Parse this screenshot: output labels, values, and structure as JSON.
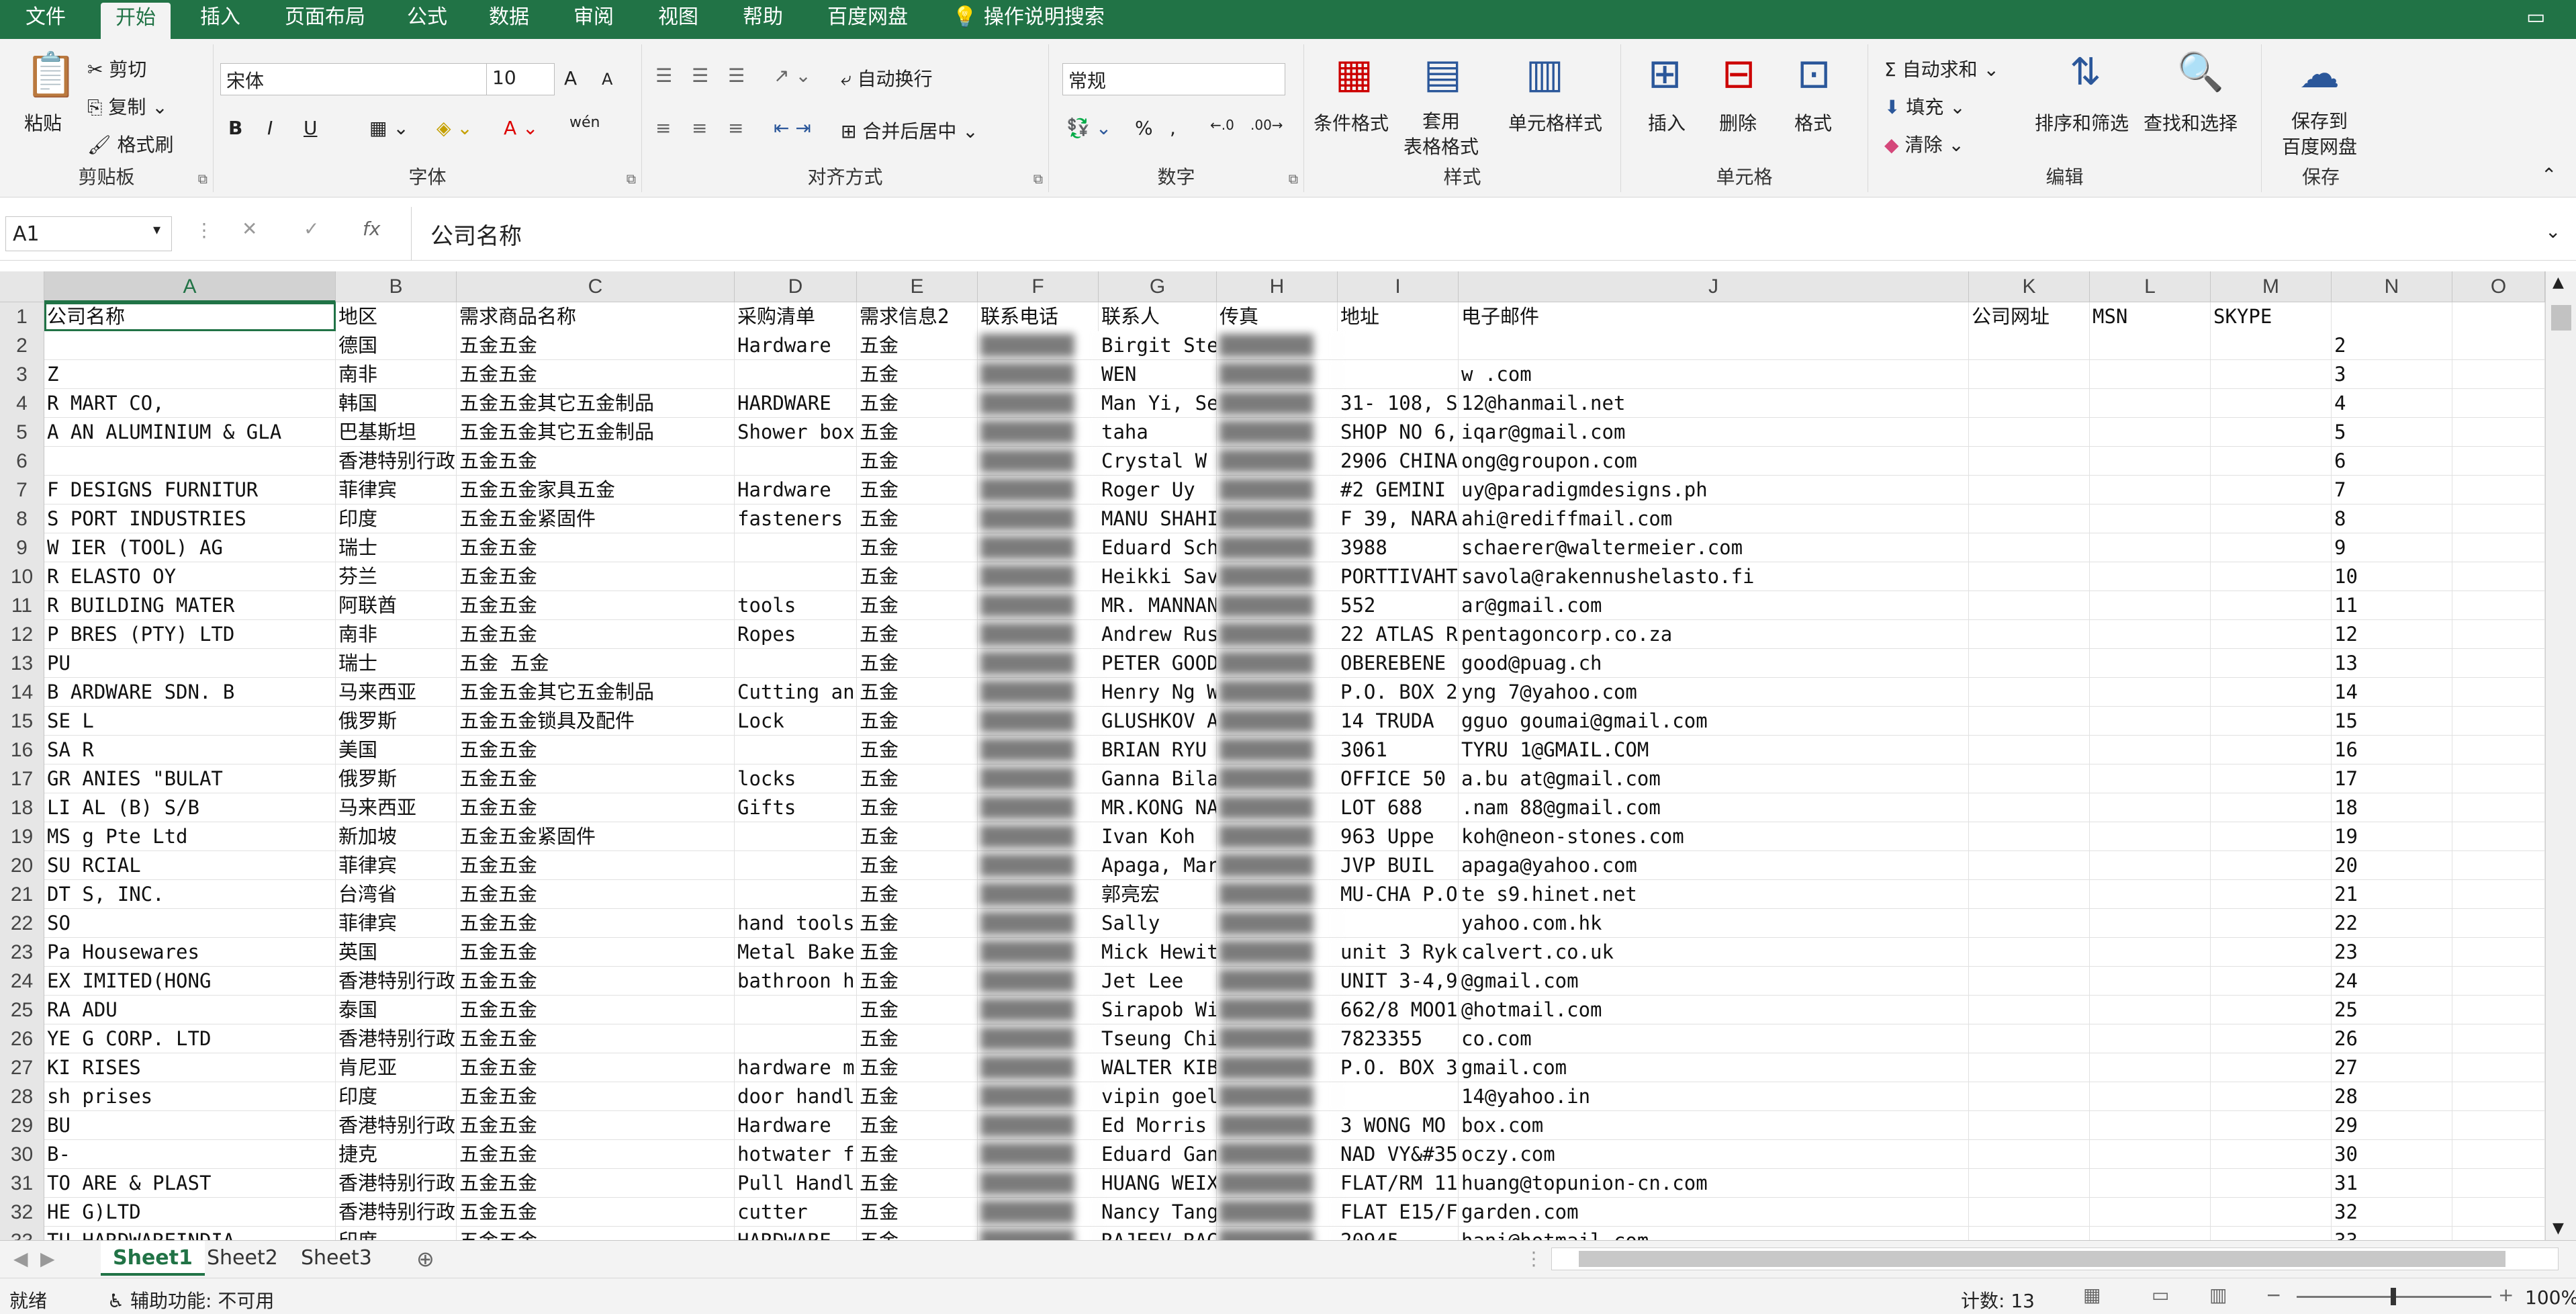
{
  "menu": {
    "tabs": [
      "文件",
      "开始",
      "插入",
      "页面布局",
      "公式",
      "数据",
      "审阅",
      "视图",
      "帮助",
      "百度网盘"
    ],
    "active_tab": "开始",
    "tell_me": "操作说明搜索"
  },
  "ribbon": {
    "clipboard": {
      "paste": "粘贴",
      "cut": "剪切",
      "copy": "复制",
      "format_painter": "格式刷",
      "label": "剪贴板"
    },
    "font": {
      "name": "宋体",
      "size": "10",
      "label": "字体",
      "bold": "B",
      "italic": "I",
      "underline": "U",
      "grow": "A",
      "shrink": "A",
      "wen": "wén"
    },
    "alignment": {
      "wrap": "自动换行",
      "merge": "合并后居中",
      "label": "对齐方式"
    },
    "number": {
      "format": "常规",
      "label": "数字",
      "percent": "%",
      "comma": ","
    },
    "styles": {
      "conditional": "条件格式",
      "table": "套用\n表格格式",
      "cell_styles": "单元格样式",
      "label": "样式"
    },
    "cells": {
      "insert": "插入",
      "delete": "删除",
      "format": "格式",
      "label": "单元格"
    },
    "editing": {
      "autosum": "自动求和",
      "fill": "填充",
      "clear": "清除",
      "sort_filter": "排序和筛选",
      "find_select": "查找和选择",
      "label": "编辑"
    },
    "save": {
      "save_to": "保存到\n百度网盘",
      "label": "保存"
    }
  },
  "formula_bar": {
    "name_box": "A1",
    "content": "公司名称",
    "fx": "fx"
  },
  "columns": [
    "A",
    "B",
    "C",
    "D",
    "E",
    "F",
    "G",
    "H",
    "I",
    "J",
    "K",
    "L",
    "M",
    "N",
    "O"
  ],
  "header_row": [
    "公司名称",
    "地区",
    "需求商品名称",
    "采购清单",
    "需求信息2",
    "联系电话",
    "联系人",
    "传真",
    "地址",
    "电子邮件",
    "公司网址",
    "MSN",
    "SKYPE",
    "",
    ""
  ],
  "rows": [
    {
      "n": "2",
      "a": "",
      "b": "德国",
      "c": "五金五金",
      "d": "Hardware",
      "e": "五金",
      "g": "Birgit Ste",
      "i": "",
      "j": ""
    },
    {
      "n": "3",
      "a": "Z",
      "b": "南非",
      "c": "五金五金",
      "d": "",
      "e": "五金",
      "g": "WEN",
      "i": "",
      "j": "w        .com"
    },
    {
      "n": "4",
      "a": "R      MART CO,",
      "b": "韩国",
      "c": "五金五金其它五金制品",
      "d": "HARDWARE",
      "e": "五金",
      "g": "Man Yi, Se",
      "i": "31- 108, S",
      "j": "         12@hanmail.net"
    },
    {
      "n": "5",
      "a": "A      AN ALUMINIUM & GLA",
      "b": "巴基斯坦",
      "c": "五金五金其它五金制品",
      "d": "Shower box",
      "e": "五金",
      "g": "taha",
      "i": "SHOP NO 6, ",
      "j": "         iqar@gmail.com"
    },
    {
      "n": "6",
      "a": "",
      "b": "香港特别行政区",
      "c": "五金五金",
      "d": "",
      "e": "五金",
      "g": "Crystal W",
      "i": "2906 CHINA",
      "j": "         ong@groupon.com"
    },
    {
      "n": "7",
      "a": "F      DESIGNS FURNITUR",
      "b": "菲律宾",
      "c": "五金五金家具五金",
      "d": "Hardware",
      "e": "五金",
      "g": "Roger Uy",
      "i": "#2 GEMINI ",
      "j": "         uy@paradigmdesigns.ph"
    },
    {
      "n": "8",
      "a": "S      PORT INDUSTRIES",
      "b": "印度",
      "c": "五金五金紧固件",
      "d": "fasteners",
      "e": "五金",
      "g": "MANU SHAHI",
      "i": "F 39, NARA",
      "j": "         ahi@rediffmail.com"
    },
    {
      "n": "9",
      "a": "W      IER (TOOL) AG",
      "b": "瑞士",
      "c": "五金五金",
      "d": "",
      "e": "五金",
      "g": "Eduard Sch",
      "i": "3988",
      "j": "         schaerer@waltermeier.com"
    },
    {
      "n": "10",
      "a": "R      ELASTO OY",
      "b": "芬兰",
      "c": "五金五金",
      "d": "",
      "e": "五金",
      "g": "Heikki Sav",
      "i": "PORTTIVAHT",
      "j": "         savola@rakennushelasto.fi"
    },
    {
      "n": "11",
      "a": "R      BUILDING MATER",
      "b": "阿联酋",
      "c": "五金五金",
      "d": "tools",
      "e": "五金",
      "g": "MR. MANNAN",
      "i": "552",
      "j": "         ar@gmail.com"
    },
    {
      "n": "12",
      "a": "P      BRES (PTY) LTD",
      "b": "南非",
      "c": "五金五金",
      "d": "Ropes",
      "e": "五金",
      "g": "Andrew Rus",
      "i": "22 ATLAS R",
      "j": "         pentagoncorp.co.za"
    },
    {
      "n": "13",
      "a": "PU",
      "b": "瑞士",
      "c": "五金 五金",
      "d": "",
      "e": "五金",
      "g": "PETER GOOD",
      "i": "OBEREBENE",
      "j": "         good@puag.ch"
    },
    {
      "n": "14",
      "a": "B      ARDWARE SDN. B",
      "b": "马来西亚",
      "c": "五金五金其它五金制品",
      "d": "Cutting an",
      "e": "五金",
      "g": "Henry Ng W",
      "i": "P.O. BOX 2",
      "j": "         yng 7@yahoo.com"
    },
    {
      "n": "15",
      "a": "SE      L",
      "b": "俄罗斯",
      "c": "五金五金锁具及配件",
      "d": "Lock",
      "e": "五金",
      "g": "GLUSHKOV A",
      "i": "14 TRUDA ",
      "j": "         gguo goumai@gmail.com"
    },
    {
      "n": "16",
      "a": "SA      R",
      "b": "美国",
      "c": "五金五金",
      "d": "",
      "e": "五金",
      "g": "BRIAN RYU",
      "i": "3061",
      "j": "         TYRU 1@GMAIL.COM"
    },
    {
      "n": "17",
      "a": "GR      ANIES \"BULAT",
      "b": "俄罗斯",
      "c": "五金五金",
      "d": "locks",
      "e": "五金",
      "g": "Ganna Bilash",
      "i": "OFFICE 50",
      "j": "         a.bu at@gmail.com"
    },
    {
      "n": "18",
      "a": "LI      AL (B) S/B",
      "b": "马来西亚",
      "c": "五金五金",
      "d": "Gifts",
      "e": "五金",
      "g": "MR.KONG NA",
      "i": "LOT 688 ",
      "j": "         .nam 88@gmail.com"
    },
    {
      "n": "19",
      "a": "MS      g Pte Ltd",
      "b": "新加坡",
      "c": "五金五金紧固件",
      "d": "",
      "e": "五金",
      "g": "Ivan Koh",
      "i": "963 Uppe",
      "j": "         koh@neon-stones.com"
    },
    {
      "n": "20",
      "a": "SU      RCIAL",
      "b": "菲律宾",
      "c": "五金五金",
      "d": "",
      "e": "五金",
      "g": "Apaga, Mar",
      "i": "JVP BUIL",
      "j": "         apaga@yahoo.com"
    },
    {
      "n": "21",
      "a": "DT      S, INC.",
      "b": "台湾省",
      "c": "五金五金",
      "d": "",
      "e": "五金",
      "g": "郭亮宏",
      "i": "MU-CHA P.O",
      "j": "         te s9.hinet.net"
    },
    {
      "n": "22",
      "a": "SO",
      "b": "菲律宾",
      "c": "五金五金",
      "d": "hand tools",
      "e": "五金",
      "g": "Sally",
      "i": "",
      "j": "         yahoo.com.hk"
    },
    {
      "n": "23",
      "a": "Pa      Housewares",
      "b": "英国",
      "c": "五金五金",
      "d": "Metal Bake",
      "e": "五金",
      "g": "Mick Hewit",
      "i": "unit 3 Ryk",
      "j": "         calvert.co.uk"
    },
    {
      "n": "24",
      "a": "EX      IMITED(HONG",
      "b": "香港特别行政区",
      "c": "五金五金",
      "d": "bathroon h",
      "e": "五金",
      "g": "Jet Lee",
      "i": "UNIT 3-4,9",
      "j": "         @gmail.com"
    },
    {
      "n": "25",
      "a": "RA      ADU",
      "b": "泰国",
      "c": "五金五金",
      "d": "",
      "e": "五金",
      "g": "Sirapob Wi",
      "i": "662/8 MOO1",
      "j": "         @hotmail.com"
    },
    {
      "n": "26",
      "a": "YE      G CORP. LTD",
      "b": "香港特别行政区",
      "c": "五金五金",
      "d": "",
      "e": "五金",
      "g": "Tseung Chi",
      "i": "7823355",
      "j": "         co.com"
    },
    {
      "n": "27",
      "a": "KI      RISES",
      "b": "肯尼亚",
      "c": "五金五金",
      "d": "hardware m",
      "e": "五金",
      "g": "WALTER KIB",
      "i": "P.O. BOX 3",
      "j": "         gmail.com"
    },
    {
      "n": "28",
      "a": "sh      prises",
      "b": "印度",
      "c": "五金五金",
      "d": "door handl",
      "e": "五金",
      "g": "vipin goel",
      "i": "",
      "j": "         14@yahoo.in"
    },
    {
      "n": "29",
      "a": "BU",
      "b": "香港特别行政区",
      "c": "五金五金",
      "d": "Hardware",
      "e": "五金",
      "g": "Ed Morris",
      "i": "3 WONG MO",
      "j": "         box.com"
    },
    {
      "n": "30",
      "a": "B-",
      "b": "捷克",
      "c": "五金五金",
      "d": "hotwater f",
      "e": "五金",
      "g": "Eduard Gan",
      "i": "NAD VY&#35",
      "j": "         oczy.com"
    },
    {
      "n": "31",
      "a": "TO      ARE & PLAST",
      "b": "香港特别行政区",
      "c": "五金五金",
      "d": "Pull Handl",
      "e": "五金",
      "g": "HUANG WEIX",
      "i": "FLAT/RM 11",
      "j": "         huang@topunion-cn.com"
    },
    {
      "n": "32",
      "a": "HE      G)LTD",
      "b": "香港特别行政区",
      "c": "五金五金",
      "d": "cutter",
      "e": "五金",
      "g": "Nancy Tang",
      "i": "FLAT E15/F",
      "j": "         garden.com"
    },
    {
      "n": "33",
      "a": "TU      HARDWAREINDIA",
      "b": "印度",
      "c": "五金五金",
      "d": "HARDWARE",
      "e": "五金",
      "g": "RAJEEV RAG",
      "i": "20945",
      "j": "         hani@hotmail.com"
    }
  ],
  "sheets": [
    "Sheet1",
    "Sheet2",
    "Sheet3"
  ],
  "active_sheet": "Sheet1",
  "status": {
    "ready": "就绪",
    "accessibility": "辅助功能: 不可用",
    "count": "计数: 13",
    "zoom": "100%"
  }
}
